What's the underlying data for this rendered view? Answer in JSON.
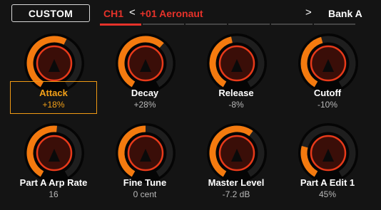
{
  "header": {
    "mode_button": "CUSTOM",
    "channel": "CH1",
    "nav_prev": "<",
    "preset": "+01 Aeronaut",
    "nav_next": ">",
    "bank": "Bank A"
  },
  "page_tabs": {
    "count": 6,
    "active_index": 0
  },
  "colors": {
    "accent_red": "#e5322a",
    "knob_orange": "#f47a0f",
    "selected_orange": "#f3a018"
  },
  "params": [
    {
      "name": "Attack",
      "value": "+18%",
      "level": 0.59,
      "selected": true
    },
    {
      "name": "Decay",
      "value": "+28%",
      "level": 0.64,
      "selected": false
    },
    {
      "name": "Release",
      "value": "-8%",
      "level": 0.46,
      "selected": false
    },
    {
      "name": "Cutoff",
      "value": "-10%",
      "level": 0.45,
      "selected": false
    },
    {
      "name": "Part A Arp Rate",
      "value": "16",
      "level": 0.52,
      "selected": false
    },
    {
      "name": "Fine Tune",
      "value": "0 cent",
      "level": 0.5,
      "selected": false
    },
    {
      "name": "Master Level",
      "value": "-7.2 dB",
      "level": 0.62,
      "selected": false
    },
    {
      "name": "Part A Edit 1",
      "value": "45%",
      "level": 0.25,
      "selected": false
    }
  ]
}
